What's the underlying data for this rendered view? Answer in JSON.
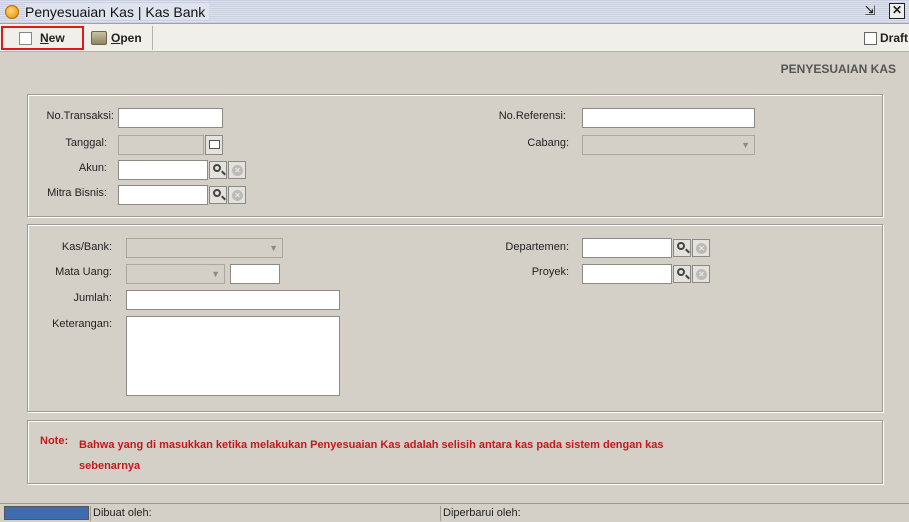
{
  "window": {
    "title": "Penyesuaian Kas | Kas Bank",
    "restore_glyph": "⇲",
    "close_glyph": "✕"
  },
  "toolbar": {
    "new_label": "New",
    "new_underline": "N",
    "new_rest": "ew",
    "open_underline": "O",
    "open_rest": "pen",
    "draft_label": "Draft"
  },
  "form": {
    "title": "PENYESUAIAN KAS",
    "header": {
      "no_transaksi_label": "No.Transaksi:",
      "no_transaksi_value": "",
      "tanggal_label": "Tanggal:",
      "tanggal_value": "",
      "akun_label": "Akun:",
      "akun_value": "",
      "mitra_label": "Mitra Bisnis:",
      "mitra_value": "",
      "no_referensi_label": "No.Referensi:",
      "no_referensi_value": "",
      "cabang_label": "Cabang:",
      "cabang_value": ""
    },
    "detail": {
      "kas_bank_label": "Kas/Bank:",
      "kas_bank_value": "",
      "mata_uang_label": "Mata Uang:",
      "mata_uang_value": "",
      "kurs_value": "",
      "jumlah_label": "Jumlah:",
      "jumlah_value": "",
      "keterangan_label": "Keterangan:",
      "keterangan_value": "",
      "departemen_label": "Departemen:",
      "departemen_value": "",
      "proyek_label": "Proyek:",
      "proyek_value": ""
    },
    "note": {
      "label": "Note:",
      "text": "Bahwa yang di masukkan ketika melakukan Penyesuaian Kas adalah selisih antara kas pada sistem dengan kas sebenarnya"
    }
  },
  "statusbar": {
    "dibuat_label": "Dibuat oleh:",
    "diperbarui_label": "Diperbarui oleh:"
  },
  "colors": {
    "note_red": "#c21a1a",
    "highlight_border": "#e01818",
    "progress_blue": "#3d6cb0"
  }
}
